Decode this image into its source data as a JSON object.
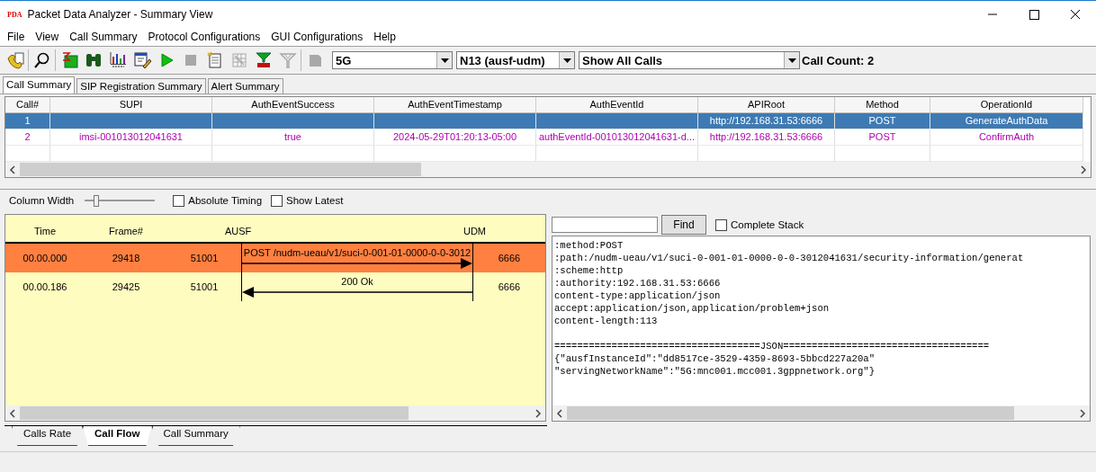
{
  "window": {
    "logo": "PDA",
    "title": "Packet Data Analyzer - Summary View"
  },
  "menu": [
    "File",
    "View",
    "Call Summary",
    "Protocol Configurations",
    "GUI Configurations",
    "Help"
  ],
  "toolbar": [
    {
      "kind": "phone-sheet",
      "disabled": false
    },
    {
      "kind": "search",
      "disabled": false
    },
    {
      "kind": "sigma-sheet",
      "disabled": false
    },
    {
      "kind": "binoculars",
      "disabled": false
    },
    {
      "kind": "bar-chart",
      "disabled": false
    },
    {
      "kind": "edit-sheet",
      "disabled": false
    },
    {
      "kind": "play",
      "disabled": false
    },
    {
      "kind": "stop",
      "disabled": true
    },
    {
      "kind": "notepad",
      "disabled": false
    },
    {
      "kind": "grid-sheet",
      "disabled": true
    },
    {
      "kind": "funnel",
      "disabled": false
    },
    {
      "kind": "antenna",
      "disabled": true
    },
    {
      "kind": "chip",
      "disabled": true
    }
  ],
  "filters": {
    "network": "5G",
    "interface": "N13 (ausf-udm)",
    "calls": "Show All Calls",
    "call_count": "Call Count: 2"
  },
  "tabs": [
    {
      "label": "Call Summary",
      "selected": true
    },
    {
      "label": "SIP Registration Summary",
      "selected": false
    },
    {
      "label": "Alert Summary",
      "selected": false
    }
  ],
  "table": {
    "columns": [
      "Call#",
      "SUPI",
      "AuthEventSuccess",
      "AuthEventTimestamp",
      "AuthEventId",
      "APIRoot",
      "Method",
      "OperationId"
    ],
    "rows": [
      {
        "selected": true,
        "cells": [
          "1",
          "",
          "",
          "",
          "",
          "http://192.168.31.53:6666",
          "POST",
          "GenerateAuthData"
        ]
      },
      {
        "selected": false,
        "cells": [
          "2",
          "imsi-001013012041631",
          "true",
          "2024-05-29T01:20:13-05:00",
          "authEventId-001013012041631-d...",
          "http://192.168.31.53:6666",
          "POST",
          "ConfirmAuth"
        ]
      }
    ]
  },
  "flow_controls": {
    "column_width": {
      "label": "Column Width",
      "level": 0.12
    },
    "options": [
      {
        "label": "Absolute Timing",
        "checked": false
      },
      {
        "label": "Show Latest",
        "checked": false
      }
    ]
  },
  "call_flow": {
    "columns": [
      "Time",
      "Frame#"
    ],
    "nodes": [
      "AUSF",
      "UDM"
    ],
    "messages": [
      {
        "time": "00.00.000",
        "frame": "29418",
        "src_port": "51001",
        "dst_port": "6666",
        "text": "POST /nudm-ueau/v1/suci-0-001-01-0000-0-0-3012",
        "kind": "request",
        "selected": true
      },
      {
        "time": "00.00.186",
        "frame": "29425",
        "src_port": "51001",
        "dst_port": "6666",
        "text": "200 Ok",
        "kind": "response",
        "selected": false
      }
    ]
  },
  "detail": {
    "find_button": "Find",
    "complete_stack": {
      "label": "Complete Stack",
      "checked": false
    },
    "header_lines": [
      ":method:POST",
      ":path:/nudm-ueau/v1/suci-0-001-01-0000-0-0-3012041631/security-information/generat",
      ":scheme:http",
      ":authority:192.168.31.53:6666",
      "content-type:application/json",
      "accept:application/json,application/problem+json",
      "content-length:113"
    ],
    "body_lines": [
      "====================================JSON====================================",
      "{\"ausfInstanceId\":\"dd8517ce-3529-4359-8693-5bbcd227a20a\"",
      "\"servingNetworkName\":\"5G:mnc001.mcc001.3gppnetwork.org\"}"
    ]
  },
  "bottom_tabs": [
    {
      "label": "Calls Rate",
      "selected": false
    },
    {
      "label": "Call Flow",
      "selected": true
    },
    {
      "label": "Call Summary",
      "selected": false
    }
  ]
}
